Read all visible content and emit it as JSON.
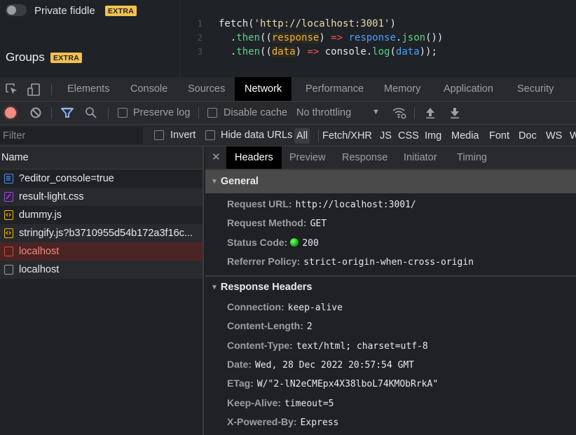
{
  "sidebar": {
    "private_fiddle_label": "Private fiddle",
    "private_fiddle_enabled": false,
    "private_fiddle_badge": "EXTRA",
    "groups_label": "Groups",
    "groups_badge": "EXTRA"
  },
  "editor": {
    "lines": [
      {
        "number": "1",
        "tokens": [
          {
            "t": "fetch(",
            "c": "plain"
          },
          {
            "t": "'http://localhost:3001'",
            "c": "str"
          },
          {
            "t": ")",
            "c": "plain"
          }
        ]
      },
      {
        "number": "2",
        "tokens": [
          {
            "t": "  .",
            "c": "plain"
          },
          {
            "t": "then",
            "c": "fn"
          },
          {
            "t": "((",
            "c": "plain"
          },
          {
            "t": "response",
            "c": "param"
          },
          {
            "t": ") ",
            "c": "plain"
          },
          {
            "t": "=>",
            "c": "arrow"
          },
          {
            "t": " ",
            "c": "plain"
          },
          {
            "t": "response",
            "c": "var"
          },
          {
            "t": ".",
            "c": "plain"
          },
          {
            "t": "json",
            "c": "fn"
          },
          {
            "t": "())",
            "c": "plain"
          }
        ]
      },
      {
        "number": "3",
        "tokens": [
          {
            "t": "  .",
            "c": "plain"
          },
          {
            "t": "then",
            "c": "fn"
          },
          {
            "t": "((",
            "c": "plain"
          },
          {
            "t": "data",
            "c": "param"
          },
          {
            "t": ") ",
            "c": "plain"
          },
          {
            "t": "=>",
            "c": "arrow"
          },
          {
            "t": " console.",
            "c": "plain"
          },
          {
            "t": "log",
            "c": "fn"
          },
          {
            "t": "(",
            "c": "plain"
          },
          {
            "t": "data",
            "c": "var"
          },
          {
            "t": "));",
            "c": "plain"
          }
        ]
      }
    ]
  },
  "devtools": {
    "tabs": [
      "Elements",
      "Console",
      "Sources",
      "Network",
      "Performance",
      "Memory",
      "Application",
      "Security"
    ],
    "active_tab": "Network",
    "toolbar": {
      "preserve_log_label": "Preserve log",
      "preserve_log_checked": false,
      "disable_cache_label": "Disable cache",
      "disable_cache_checked": false,
      "throttling_value": "No throttling"
    },
    "filterbar": {
      "filter_placeholder": "Filter",
      "filter_value": "",
      "invert_label": "Invert",
      "hide_data_urls_label": "Hide data URLs",
      "types": [
        "All",
        "Fetch/XHR",
        "JS",
        "CSS",
        "Img",
        "Media",
        "Font",
        "Doc",
        "WS",
        "W"
      ],
      "active_type": "All"
    },
    "requests": {
      "column_name": "Name",
      "rows": [
        {
          "name": "?editor_console=true",
          "type": "document",
          "status": "ok"
        },
        {
          "name": "result-light.css",
          "type": "stylesheet",
          "status": "ok"
        },
        {
          "name": "dummy.js",
          "type": "script",
          "status": "ok"
        },
        {
          "name": "stringify.js?b3710955d54b172a3f16c...",
          "type": "script",
          "status": "ok"
        },
        {
          "name": "localhost",
          "type": "fetch",
          "status": "error"
        },
        {
          "name": "localhost",
          "type": "fetch",
          "status": "ok"
        }
      ]
    },
    "details": {
      "tabs": [
        "Headers",
        "Preview",
        "Response",
        "Initiator",
        "Timing"
      ],
      "active_tab": "Headers",
      "general": {
        "title": "General",
        "request_url_key": "Request URL:",
        "request_url": "http://localhost:3001/",
        "request_method_key": "Request Method:",
        "request_method": "GET",
        "status_code_key": "Status Code:",
        "status_code": "200",
        "status_color": "#1ec21b",
        "referrer_policy_key": "Referrer Policy:",
        "referrer_policy": "strict-origin-when-cross-origin"
      },
      "response_headers": {
        "title": "Response Headers",
        "items": [
          {
            "key": "Connection:",
            "value": "keep-alive"
          },
          {
            "key": "Content-Length:",
            "value": "2"
          },
          {
            "key": "Content-Type:",
            "value": "text/html; charset=utf-8"
          },
          {
            "key": "Date:",
            "value": "Wed, 28 Dec 2022 20:57:54 GMT"
          },
          {
            "key": "ETag:",
            "value": "W/\"2-lN2eCMEpx4X38lboL74KMObRrkA\""
          },
          {
            "key": "Keep-Alive:",
            "value": "timeout=5"
          },
          {
            "key": "X-Powered-By:",
            "value": "Express"
          }
        ]
      }
    }
  },
  "colors": {
    "accent_badge": "#f2c14e",
    "record_button": "#f28b82",
    "filter_icon": "#8ab4f8",
    "error_text": "#f28b82"
  }
}
